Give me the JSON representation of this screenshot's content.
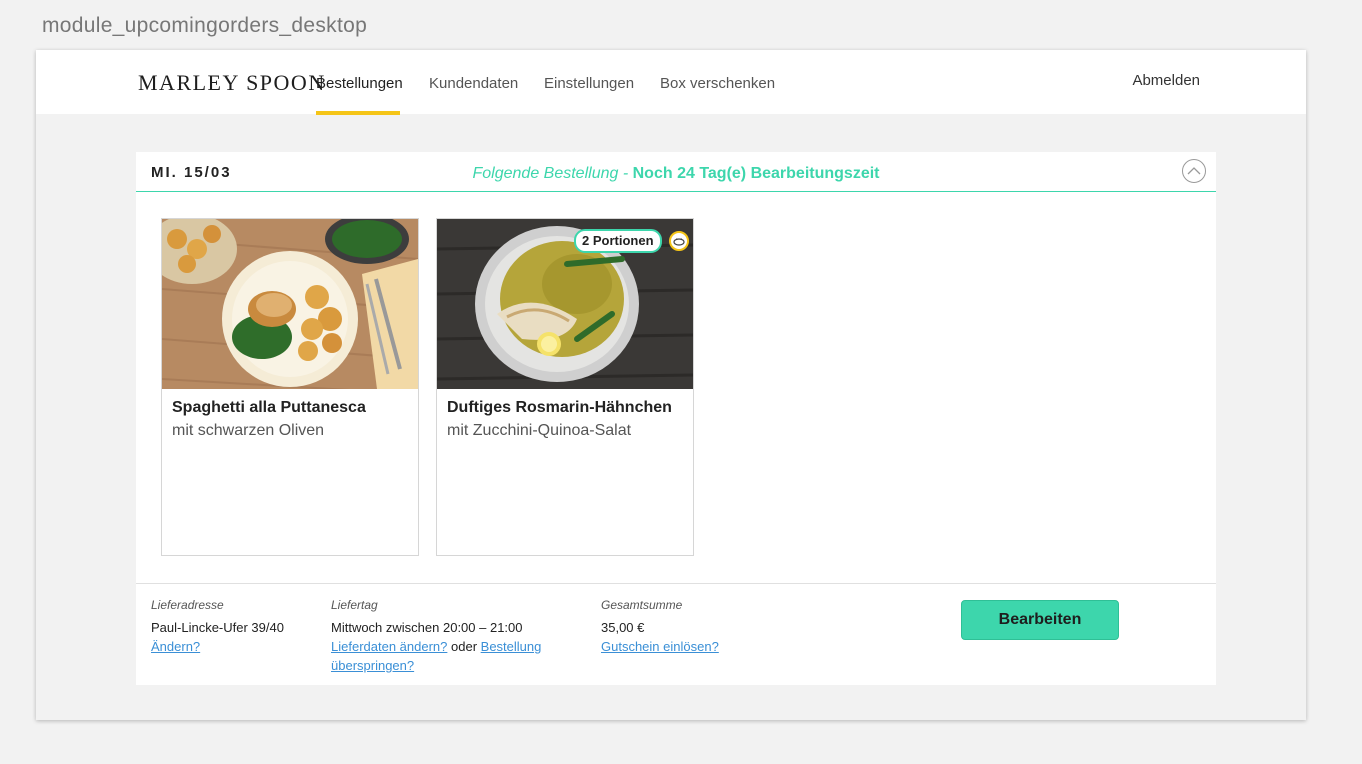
{
  "artboard_label": "module_upcomingorders_desktop",
  "header": {
    "logo": "MARLEY SPOON",
    "nav": [
      "Bestellungen",
      "Kundendaten",
      "Einstellungen",
      "Box verschenken"
    ],
    "active_nav": "Bestellungen",
    "logout": "Abmelden"
  },
  "order": {
    "date": "MI. 15/03",
    "next_label": "Folgende Bestellung",
    "separator": "-",
    "edit_time": "Noch 24 Tag(e) Bearbeitungszeit",
    "recipes": [
      {
        "title": "Spaghetti alla Puttanesca",
        "subtitle": "mit schwarzen Oliven"
      },
      {
        "title": "Duftiges Rosmarin-Hähnchen",
        "subtitle": "mit Zucchini-Quinoa-Salat",
        "portions": "2 Portionen",
        "badge_icon": "food-badge-icon"
      }
    ],
    "footer": {
      "address_label": "Lieferadresse",
      "address": "Paul-Lincke-Ufer 39/40",
      "address_change": "Ändern?",
      "day_label": "Liefertag",
      "day": "Mittwoch zwischen 20:00 – 21:00",
      "day_change": "Lieferdaten ändern?",
      "or": "oder",
      "skip": "Bestellung überspringen?",
      "total_label": "Gesamtsumme",
      "total": "35,00 €",
      "voucher": "Gutschein einlösen?",
      "edit_button": "Bearbeiten"
    }
  },
  "colors": {
    "accent": "#3dd6ac",
    "nav_underline": "#f5c518",
    "link": "#3a8fd6"
  }
}
